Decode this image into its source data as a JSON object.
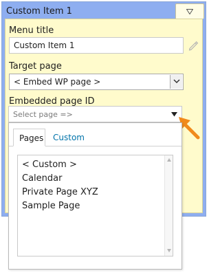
{
  "panel": {
    "title": "Custom Item 1"
  },
  "fields": {
    "menu_title": {
      "label": "Menu title",
      "value": "Custom Item 1"
    },
    "target_page": {
      "label": "Target page",
      "selected": "< Embed WP page >"
    },
    "embedded_page": {
      "label": "Embedded page ID",
      "placeholder": "Select page =>"
    }
  },
  "dropdown": {
    "tabs": [
      {
        "label": "Pages",
        "active": true
      },
      {
        "label": "Custom",
        "active": false
      }
    ],
    "items": [
      "< Custom >",
      "Calendar",
      "Private Page XYZ",
      "Sample Page"
    ]
  },
  "colors": {
    "panel_header": "#8eaef0",
    "panel_body": "#fffbcc",
    "callout_arrow": "#f08a1c",
    "link_tab": "#0073aa"
  }
}
